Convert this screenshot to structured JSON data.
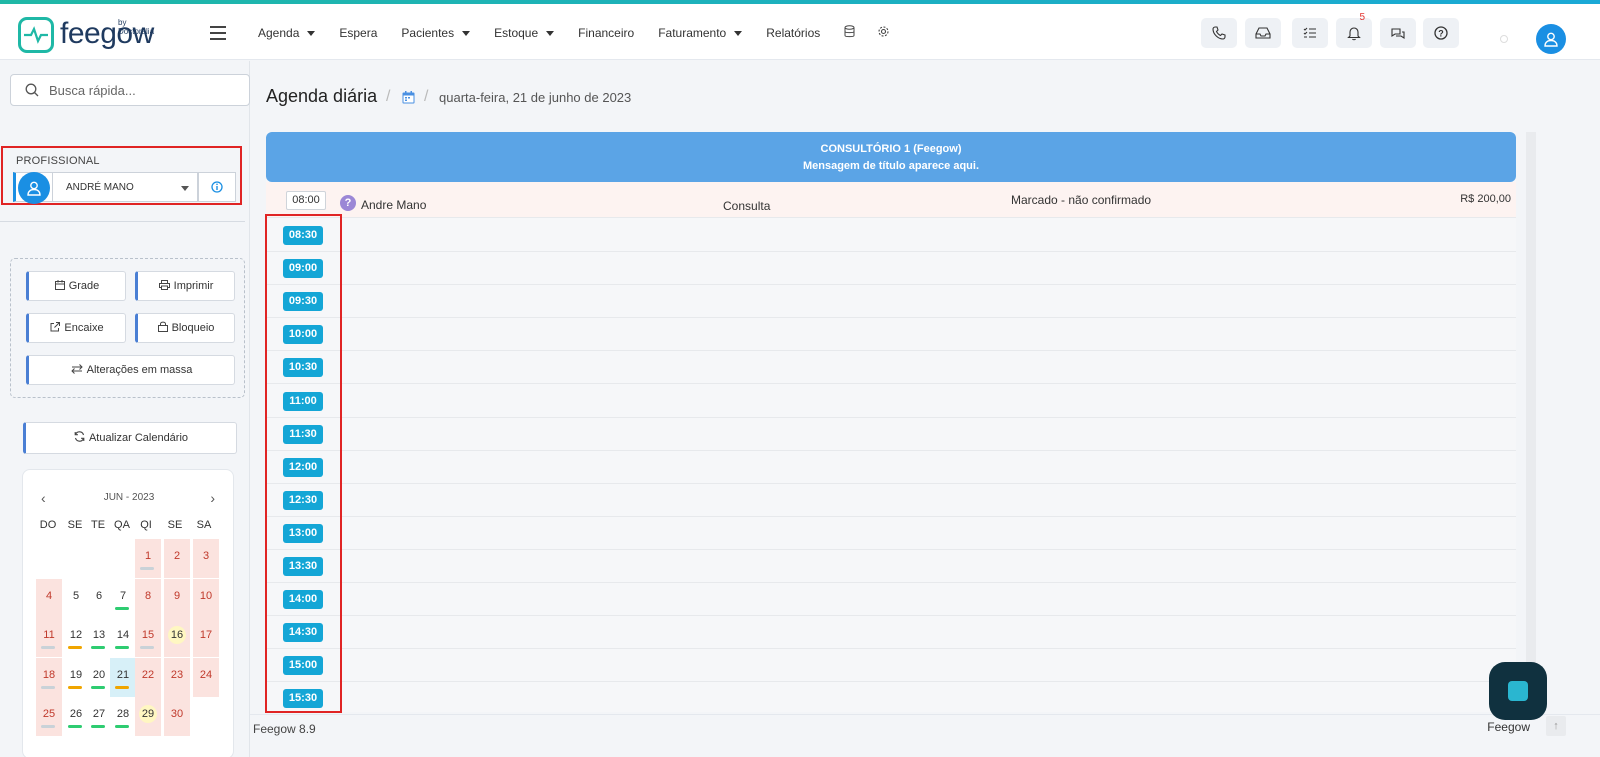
{
  "app": {
    "logo_text": "feegow",
    "logo_by": "by Doctoralia"
  },
  "nav": {
    "items": [
      {
        "label": "Agenda",
        "has_caret": true
      },
      {
        "label": "Espera",
        "has_caret": false
      },
      {
        "label": "Pacientes",
        "has_caret": true
      },
      {
        "label": "Estoque",
        "has_caret": true
      },
      {
        "label": "Financeiro",
        "has_caret": false
      },
      {
        "label": "Faturamento",
        "has_caret": true
      },
      {
        "label": "Relatórios",
        "has_caret": false
      }
    ],
    "icons": [
      "database-icon",
      "gear-icon"
    ],
    "right_buttons": [
      "phone-icon",
      "inbox-icon",
      "checklist-icon",
      "bell-icon",
      "chat-icon",
      "help-icon"
    ],
    "notification_count": "5"
  },
  "sidebar": {
    "search_placeholder": "Busca rápida...",
    "profissional_label": "PROFISSIONAL",
    "profissional_selected": "ANDRÉ MANO",
    "actions": {
      "grade": "Grade",
      "imprimir": "Imprimir",
      "encaixe": "Encaixe",
      "bloqueio": "Bloqueio",
      "alteracoes": "Alterações em massa"
    },
    "refresh_label": "Atualizar Calendário"
  },
  "calendar": {
    "month_label": "JUN - 2023",
    "weekdays": [
      "DO",
      "SE",
      "TE",
      "QA",
      "QI",
      "SE",
      "SA"
    ],
    "days": [
      {
        "d": "1",
        "col": 4,
        "row": 0,
        "weekend": true,
        "bar": "#c9d2d8"
      },
      {
        "d": "2",
        "col": 5,
        "row": 0,
        "weekend": true
      },
      {
        "d": "3",
        "col": 6,
        "row": 0,
        "weekend": true
      },
      {
        "d": "4",
        "col": 0,
        "row": 1,
        "weekend": true
      },
      {
        "d": "5",
        "col": 1,
        "row": 1
      },
      {
        "d": "6",
        "col": 2,
        "row": 1
      },
      {
        "d": "7",
        "col": 3,
        "row": 1,
        "bar": "#2ecc71"
      },
      {
        "d": "8",
        "col": 4,
        "row": 1,
        "weekend": true
      },
      {
        "d": "9",
        "col": 5,
        "row": 1,
        "weekend": true
      },
      {
        "d": "10",
        "col": 6,
        "row": 1,
        "weekend": true
      },
      {
        "d": "11",
        "col": 0,
        "row": 2,
        "weekend": true,
        "bar": "#c9d2d8"
      },
      {
        "d": "12",
        "col": 1,
        "row": 2,
        "bar": "#f0a500"
      },
      {
        "d": "13",
        "col": 2,
        "row": 2,
        "bar": "#2ecc71"
      },
      {
        "d": "14",
        "col": 3,
        "row": 2,
        "bar": "#2ecc71"
      },
      {
        "d": "15",
        "col": 4,
        "row": 2,
        "weekend": true,
        "bar": "#c9d2d8"
      },
      {
        "d": "16",
        "col": 5,
        "row": 2,
        "weekend": true,
        "highlight": true
      },
      {
        "d": "17",
        "col": 6,
        "row": 2,
        "weekend": true
      },
      {
        "d": "18",
        "col": 0,
        "row": 3,
        "weekend": true,
        "bar": "#c9d2d8"
      },
      {
        "d": "19",
        "col": 1,
        "row": 3,
        "bar": "#f0a500"
      },
      {
        "d": "20",
        "col": 2,
        "row": 3,
        "bar": "#2ecc71"
      },
      {
        "d": "21",
        "col": 3,
        "row": 3,
        "selected": true,
        "bar": "#f0a500"
      },
      {
        "d": "22",
        "col": 4,
        "row": 3,
        "weekend": true
      },
      {
        "d": "23",
        "col": 5,
        "row": 3,
        "weekend": true
      },
      {
        "d": "24",
        "col": 6,
        "row": 3,
        "weekend": true
      },
      {
        "d": "25",
        "col": 0,
        "row": 4,
        "weekend": true,
        "bar": "#c9d2d8"
      },
      {
        "d": "26",
        "col": 1,
        "row": 4,
        "bar": "#2ecc71"
      },
      {
        "d": "27",
        "col": 2,
        "row": 4,
        "bar": "#2ecc71"
      },
      {
        "d": "28",
        "col": 3,
        "row": 4,
        "bar": "#2ecc71"
      },
      {
        "d": "29",
        "col": 4,
        "row": 4,
        "weekend": true,
        "highlight": true
      },
      {
        "d": "30",
        "col": 5,
        "row": 4,
        "weekend": true
      }
    ]
  },
  "main": {
    "title": "Agenda diária",
    "date": "quarta-feira, 21 de junho de 2023",
    "header_line1": "CONSULTÓRIO 1 (Feegow)",
    "header_line2": "Mensagem de título aparece aqui.",
    "appointment": {
      "time": "08:00",
      "patient": "Andre Mano",
      "type": "Consulta",
      "status": "Marcado - não confirmado",
      "price": "R$ 200,00"
    },
    "slots": [
      "08:30",
      "09:00",
      "09:30",
      "10:00",
      "10:30",
      "11:00",
      "11:30",
      "12:00",
      "12:30",
      "13:00",
      "13:30",
      "14:00",
      "14:30",
      "15:00",
      "15:30"
    ]
  },
  "footer": {
    "version": "Feegow 8.9",
    "brand": "Feegow"
  },
  "colors": {
    "accent": "#14a6d6",
    "header_blue": "#5ba4e6",
    "brand_teal": "#1fb8a6"
  }
}
